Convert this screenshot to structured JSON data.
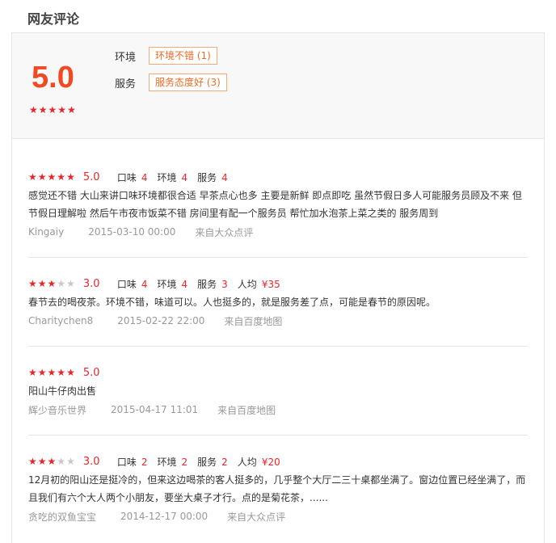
{
  "section_title": "网友评论",
  "summary": {
    "score": "5.0",
    "stars": 5,
    "tags": [
      {
        "label": "环境",
        "tag": "环境不错 (1)"
      },
      {
        "label": "服务",
        "tag": "服务态度好 (3)"
      }
    ]
  },
  "reviews": [
    {
      "stars": 5,
      "score": "5.0",
      "subs": [
        {
          "label": "口味",
          "value": "4"
        },
        {
          "label": "环境",
          "value": "4"
        },
        {
          "label": "服务",
          "value": "4"
        }
      ],
      "content": [
        "感觉还不错 大山来讲口味环境都很合适 早茶点心也多 主要是新鲜 即点即吃 虽然节假日多人可能服务员顾及不来 但",
        "节假日理解啦 然后午市夜市饭菜不错 房间里有配一个服务员 帮忙加水泡茶上菜之类的 服务周到"
      ],
      "user": "Kingaiy",
      "time": "2015-03-10 00:00",
      "source": "来自大众点评"
    },
    {
      "stars": 3,
      "score": "3.0",
      "subs": [
        {
          "label": "口味",
          "value": "4"
        },
        {
          "label": "环境",
          "value": "4"
        },
        {
          "label": "服务",
          "value": "3"
        },
        {
          "label": "人均",
          "value": "¥35"
        }
      ],
      "content": [
        "春节去的喝夜茶。环境不错，味道可以。人也挺多的，就是服务差了点，可能是春节的原因呢。"
      ],
      "user": "Charitychen8",
      "time": "2015-02-22 22:00",
      "source": "来自百度地图"
    },
    {
      "stars": 5,
      "score": "5.0",
      "subs": [],
      "content": [
        "阳山牛仔肉出售"
      ],
      "user": "辉少音乐世界",
      "time": "2015-04-17 11:01",
      "source": "来自百度地图"
    },
    {
      "stars": 3,
      "score": "3.0",
      "subs": [
        {
          "label": "口味",
          "value": "2"
        },
        {
          "label": "环境",
          "value": "2"
        },
        {
          "label": "服务",
          "value": "2"
        },
        {
          "label": "人均",
          "value": "¥20"
        }
      ],
      "content": [
        "12月初的阳山还是挺冷的，但来这边喝茶的客人挺多的，几乎整个大厅二三十桌都坐满了。窗边位置已经坐满了，而",
        "且我们有六个大人两个小朋友，要坐大桌子才行。点的是菊花茶，......"
      ],
      "user": "贪吃的双鱼宝宝",
      "time": "2014-12-17 00:00",
      "source": "来自大众点评"
    }
  ],
  "colors": {
    "accent": "#e8262a",
    "score_orange": "#f04a23",
    "tag_orange": "#f06a23"
  }
}
